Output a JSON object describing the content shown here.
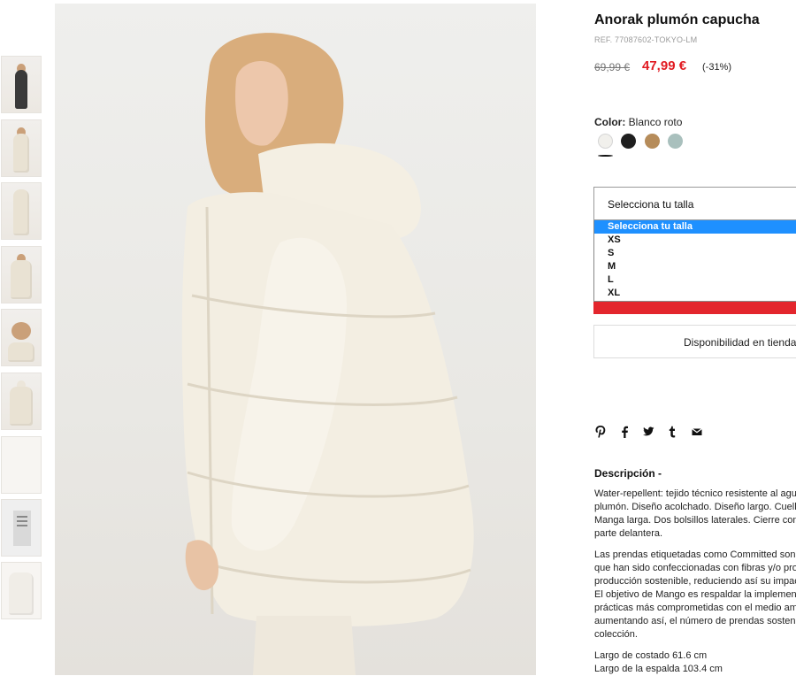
{
  "product": {
    "title": "Anorak plumón capucha",
    "ref": "REF. 77087602-TOKYO-LM",
    "old_price": "69,99 €",
    "price": "47,99 €",
    "discount": "(-31%)"
  },
  "color": {
    "label": "Color:",
    "selected": "Blanco roto",
    "swatches": [
      "#f1f0ec",
      "#1f1f1f",
      "#b68c5a",
      "#a9c0bd"
    ]
  },
  "size": {
    "placeholder": "Selecciona tu talla",
    "options": [
      "Selecciona tu talla",
      "XS",
      "S",
      "M",
      "L",
      "XL"
    ]
  },
  "availability_label": "Disponibilidad en tienda",
  "social_icons": [
    "pinterest-icon",
    "facebook-icon",
    "twitter-icon",
    "tumblr-icon",
    "email-icon"
  ],
  "description": {
    "title": "Descripción -",
    "para1": [
      "Water-repellent: tejido técnico resistente al agua",
      "plumón. Diseño acolchado. Diseño largo. Cuello",
      "Manga larga. Dos bolsillos laterales. Cierre con",
      "parte delantera."
    ],
    "para2": [
      "Las prendas etiquetadas como Committed son",
      "que han sido confeccionadas con fibras y/o procesos",
      "producción sostenible, reduciendo así su impacto",
      "El objetivo de Mango es respaldar la implementación",
      "prácticas más comprometidas con el medio ambiente",
      "aumentando así, el número de prendas sostenibles",
      "colección."
    ],
    "measures": [
      "Largo de costado 61.6 cm",
      "Largo de la espalda 103.4 cm"
    ]
  }
}
